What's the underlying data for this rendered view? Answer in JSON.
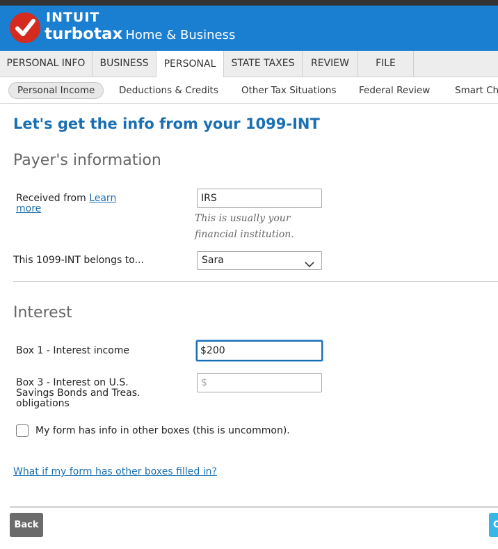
{
  "brand": {
    "company": "INTUIT",
    "product": "turbotax",
    "edition": "Home & Business",
    "logo_icon": "checkmark-icon",
    "colors": {
      "header_bg": "#1a7ed1",
      "logo_red": "#d52b1e",
      "accent_link": "#1a6fb3"
    }
  },
  "tabs": [
    {
      "label": "PERSONAL INFO",
      "active": false
    },
    {
      "label": "BUSINESS",
      "active": false
    },
    {
      "label": "PERSONAL",
      "active": true
    },
    {
      "label": "STATE TAXES",
      "active": false
    },
    {
      "label": "REVIEW",
      "active": false
    },
    {
      "label": "FILE",
      "active": false
    }
  ],
  "subnav": [
    {
      "label": "Personal Income",
      "active": true
    },
    {
      "label": "Deductions & Credits",
      "active": false
    },
    {
      "label": "Other Tax Situations",
      "active": false
    },
    {
      "label": "Federal Review",
      "active": false
    },
    {
      "label": "Smart Che",
      "active": false
    }
  ],
  "page": {
    "heading": "Let's get the info from your 1099-INT"
  },
  "payer": {
    "section_title": "Payer's information",
    "received_from_label": "Received from",
    "learn_more_link": "Learn more",
    "received_from_value": "IRS",
    "hint": "This is usually your financial institution.",
    "belongs_to_label": "This 1099-INT belongs to...",
    "belongs_to_value": "Sara",
    "dropdown_icon": "chevron-down-icon"
  },
  "interest": {
    "section_title": "Interest",
    "box1_label": "Box 1 - Interest income",
    "box1_value": "$200",
    "box3_label": "Box 3 - Interest on U.S. Savings Bonds and Treas. obligations",
    "box3_placeholder": "$",
    "other_boxes_checkbox_label": "My form has info in other boxes (this is uncommon).",
    "other_boxes_checked": false,
    "help_link": "What if my form has other boxes filled in?"
  },
  "footer": {
    "back_label": "Back",
    "continue_label": "C"
  }
}
